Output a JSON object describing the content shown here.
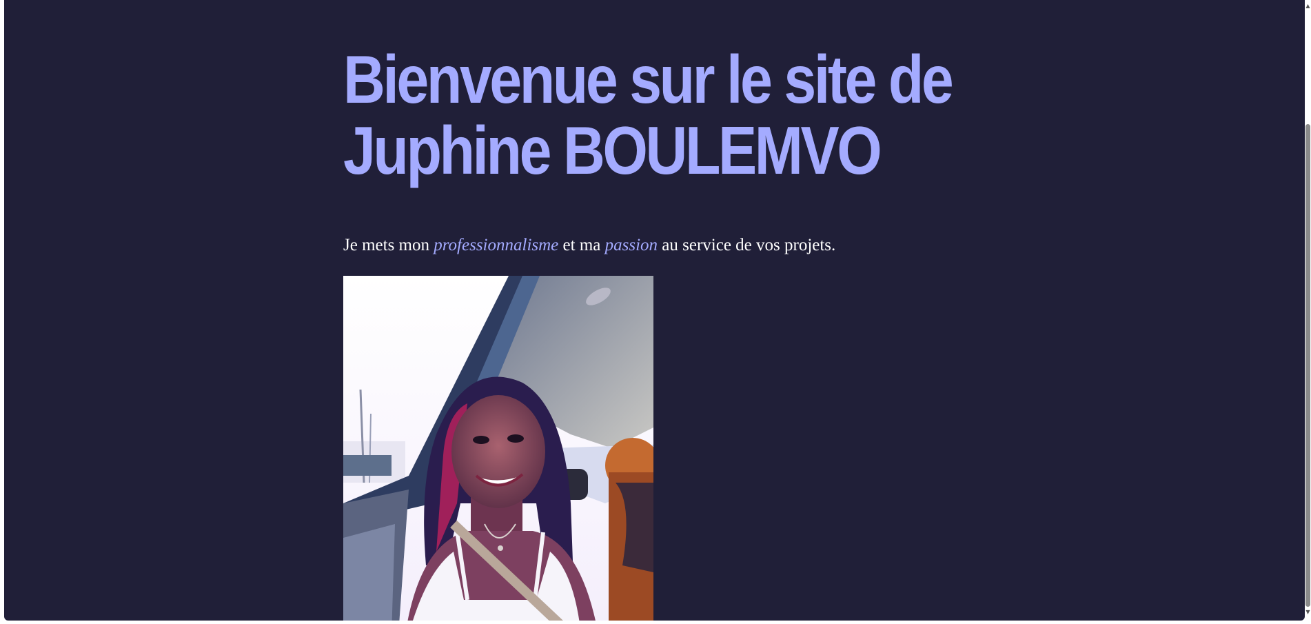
{
  "hero": {
    "title": "Bienvenue sur le site de Juphine BOULEMVO",
    "tagline": {
      "part1": "Je mets mon ",
      "em1": "professionnalisme",
      "part2": " et ma ",
      "em2": "passion",
      "part3": " au service de vos projets."
    }
  },
  "colors": {
    "background": "#201f38",
    "accent": "#a4abff",
    "text": "#ffffff"
  },
  "photo": {
    "icon": "portrait-photo"
  }
}
